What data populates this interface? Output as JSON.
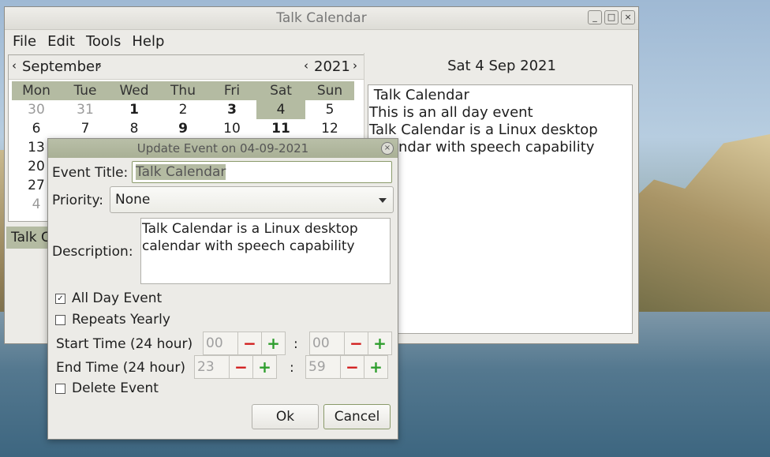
{
  "window": {
    "title": "Talk Calendar",
    "controls": {
      "minimize": "_",
      "maximize": "□",
      "close": "×"
    }
  },
  "menu": [
    "File",
    "Edit",
    "Tools",
    "Help"
  ],
  "calendar": {
    "prev_month_glyph": "‹",
    "next_month_glyph": "›",
    "prev_year_glyph": "‹",
    "next_year_glyph": "›",
    "month": "September",
    "year": "2021",
    "weekdays": [
      "Mon",
      "Tue",
      "Wed",
      "Thu",
      "Fri",
      "Sat",
      "Sun"
    ],
    "rows": [
      [
        "30",
        "31",
        "1",
        "2",
        "3",
        "4",
        "5"
      ],
      [
        "6",
        "7",
        "8",
        "9",
        "10",
        "11",
        "12"
      ],
      [
        "13",
        "",
        "",
        "",
        "",
        "",
        ""
      ],
      [
        "20",
        "",
        "",
        "",
        "",
        "",
        ""
      ],
      [
        "27",
        "",
        "",
        "",
        "",
        "",
        ""
      ],
      [
        "4",
        "",
        "",
        "",
        "",
        "",
        ""
      ]
    ]
  },
  "sidebar_strip": "Talk C",
  "selected_date": "Sat  4 Sep 2021",
  "event_list": [
    " Talk Calendar",
    "This is an all day event",
    "Talk Calendar is a Linux desktop",
    "calendar with speech capability"
  ],
  "dialog": {
    "title": "Update Event on 04-09-2021",
    "close_glyph": "×",
    "event_title_label": "Event Title:",
    "event_title_value": "Talk Calendar",
    "priority_label": "Priority:",
    "priority_value": "None",
    "description_label": "Description:",
    "description_lines": [
      "Talk Calendar is a Linux desktop",
      "calendar with speech capability"
    ],
    "all_day": {
      "label": "All Day Event",
      "checked": true,
      "mark": "✓"
    },
    "repeats_yearly": {
      "label": "Repeats Yearly",
      "checked": false
    },
    "start_label": "Start Time (24 hour)",
    "start_hour": "00",
    "start_minute": "00",
    "end_label": "End Time (24 hour)",
    "end_hour": "23",
    "end_minute": "59",
    "colon": ":",
    "minus": "−",
    "plus": "+",
    "delete_event": {
      "label": "Delete Event",
      "checked": false
    },
    "ok_label": "Ok",
    "cancel_label": "Cancel"
  }
}
